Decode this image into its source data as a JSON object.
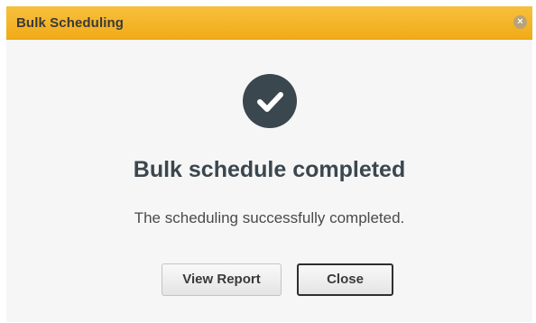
{
  "dialog": {
    "title": "Bulk Scheduling",
    "close_glyph": "×",
    "icon": "check-icon",
    "heading": "Bulk schedule completed",
    "message": "The scheduling successfully completed.",
    "buttons": {
      "view_report": "View Report",
      "close": "Close"
    }
  },
  "colors": {
    "titlebar": "#f3b428",
    "icon_circle": "#3b474f",
    "background": "#f6f6f6"
  }
}
